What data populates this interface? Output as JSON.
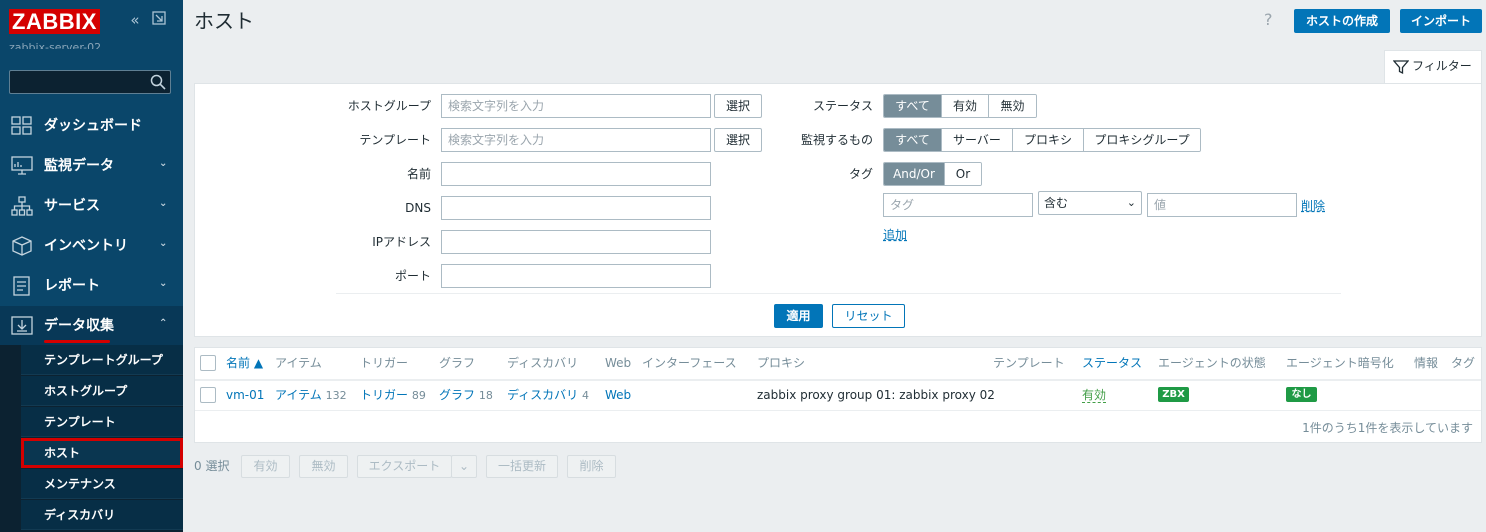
{
  "sidebar": {
    "logo": "ZABBIX",
    "server_name": "zabbix-server-02",
    "nav": [
      {
        "label": "ダッシュボード"
      },
      {
        "label": "監視データ"
      },
      {
        "label": "サービス"
      },
      {
        "label": "インベントリ"
      },
      {
        "label": "レポート"
      },
      {
        "label": "データ収集"
      }
    ],
    "sub": [
      {
        "label": "テンプレートグループ"
      },
      {
        "label": "ホストグループ"
      },
      {
        "label": "テンプレート"
      },
      {
        "label": "ホスト"
      },
      {
        "label": "メンテナンス"
      },
      {
        "label": "ディスカバリ"
      }
    ]
  },
  "header": {
    "title": "ホスト",
    "help": "?",
    "create_host": "ホストの作成",
    "import": "インポート"
  },
  "filter": {
    "tab_label": "フィルター",
    "host_group_label": "ホストグループ",
    "template_label": "テンプレート",
    "name_label": "名前",
    "dns_label": "DNS",
    "ip_label": "IPアドレス",
    "port_label": "ポート",
    "search_placeholder": "検索文字列を入力",
    "select_btn": "選択",
    "status_label": "ステータス",
    "status_options": [
      "すべて",
      "有効",
      "無効"
    ],
    "monitored_label": "監視するもの",
    "monitored_options": [
      "すべて",
      "サーバー",
      "プロキシ",
      "プロキシグループ"
    ],
    "tag_label": "タグ",
    "tag_options": [
      "And/Or",
      "Or"
    ],
    "tag_placeholder": "タグ",
    "tag_operator": "含む",
    "value_placeholder": "値",
    "remove_link": "削除",
    "add_link": "追加",
    "apply": "適用",
    "reset": "リセット"
  },
  "table": {
    "headers": {
      "name": "名前 ▲",
      "items": "アイテム",
      "triggers": "トリガー",
      "graphs": "グラフ",
      "discovery": "ディスカバリ",
      "web": "Web",
      "interface": "インターフェース",
      "proxy": "プロキシ",
      "templates": "テンプレート",
      "status": "ステータス",
      "agent_status": "エージェントの状態",
      "agent_encryption": "エージェント暗号化",
      "info": "情報",
      "tags": "タグ"
    },
    "rows": [
      {
        "name": "vm-01",
        "items": "アイテム",
        "items_count": "132",
        "triggers": "トリガー",
        "triggers_count": "89",
        "graphs": "グラフ",
        "graphs_count": "18",
        "discovery": "ディスカバリ",
        "discovery_count": "4",
        "web": "Web",
        "proxy": "zabbix proxy group 01: zabbix proxy 02",
        "status": "有効",
        "agent_badge": "ZBX",
        "encryption_badge": "なし"
      }
    ],
    "footer": "1件のうち1件を表示しています"
  },
  "actions": {
    "selected": "0 選択",
    "enable": "有効",
    "disable": "無効",
    "export": "エクスポート",
    "mass_update": "一括更新",
    "delete": "削除"
  },
  "colors": {
    "sidebar_bg": "#0a466a",
    "accent": "#0275b8",
    "brand_red": "#d40000",
    "badge_green": "#1f9a45",
    "status_green": "#429e47"
  }
}
